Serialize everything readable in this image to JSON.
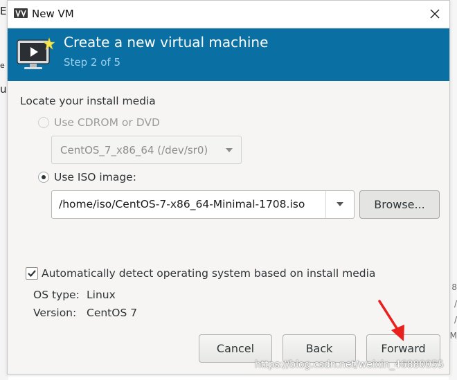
{
  "window": {
    "title": "New VM",
    "banner_title": "Create a new virtual machine",
    "banner_step": "Step 2 of 5"
  },
  "background": {
    "left_fragments": [
      "E",
      "e",
      "u"
    ],
    "right_fragments": [
      "8",
      "/",
      "/",
      "M"
    ]
  },
  "install_media": {
    "section_label": "Locate your install media",
    "cdrom_option_label": "Use CDROM or DVD",
    "cdrom_device": "CentOS_7_x86_64 (/dev/sr0)",
    "iso_option_label": "Use ISO image:",
    "iso_path": "/home/iso/CentOS-7-x86_64-Minimal-1708.iso",
    "browse_label": "Browse..."
  },
  "os_detection": {
    "auto_detect_label": "Automatically detect operating system based on install media",
    "auto_detect_checked": true,
    "os_type_label": "OS type:",
    "os_type_value": "Linux",
    "version_label": "Version:",
    "version_value": "CentOS 7"
  },
  "footer": {
    "cancel_label": "Cancel",
    "back_label": "Back",
    "forward_label": "Forward"
  },
  "watermark": "https://blog.csdn.net/weixin_46880055",
  "colors": {
    "banner": "#0a6fa3",
    "annotation_arrow": "#e8211e"
  }
}
